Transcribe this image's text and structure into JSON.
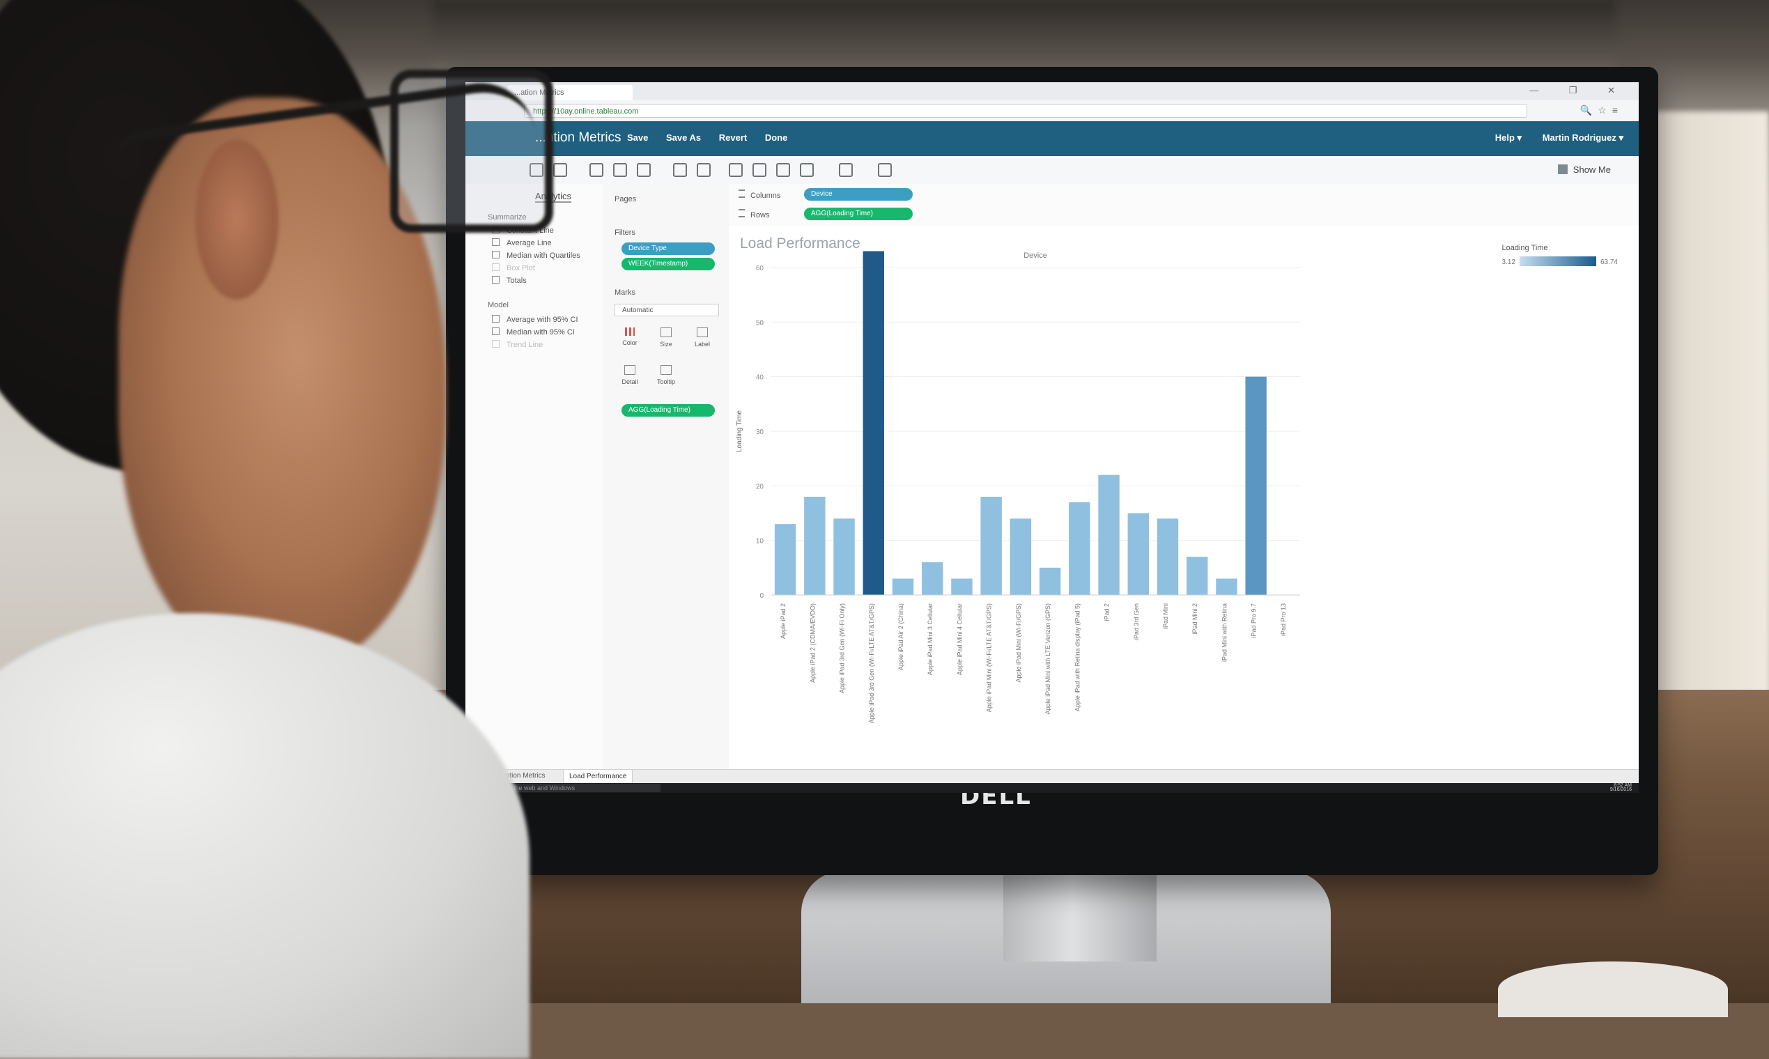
{
  "browser": {
    "tab_label": "...ation Metrics",
    "url": "https://10ay.online.tableau.com",
    "window_controls": "— ❐ ✕",
    "address_icons": "🔍☆≡"
  },
  "app": {
    "title": "...ntion Metrics",
    "menu": [
      "Save",
      "Save As",
      "Revert",
      "Done"
    ],
    "help_label": "Help ▾",
    "user_label": "Martin Rodriguez ▾",
    "show_me": "Show Me"
  },
  "analytics_pane": {
    "tab_label": "Analytics",
    "summarize_label": "Summarize",
    "summarize_items": [
      "Constant Line",
      "Average Line",
      "Median with Quartiles",
      "Box Plot",
      "Totals"
    ],
    "model_label": "Model",
    "model_items": [
      "Average with 95% CI",
      "Median with 95% CI",
      "Trend Line"
    ]
  },
  "cards": {
    "pages_label": "Pages",
    "filters_label": "Filters",
    "filters": [
      "Device Type",
      "WEEK(Timestamp)"
    ],
    "marks_label": "Marks",
    "mark_type": "Automatic",
    "mark_buttons": [
      "Color",
      "Size",
      "Label",
      "Detail",
      "Tooltip"
    ],
    "color_pill": "AGG(Loading Time)"
  },
  "shelves": {
    "columns_label": "Columns",
    "columns_pill": "Device",
    "rows_label": "Rows",
    "rows_pill": "AGG(Loading Time)"
  },
  "sheet_title": "Load Performance",
  "legend": {
    "title": "Loading Time",
    "min": "3.12",
    "max": "63.74"
  },
  "colors": {
    "bar_light": "#8fc0e0",
    "bar_mid": "#5b95c2",
    "bar_dark": "#1f5a8a",
    "header": "#1f5f80",
    "pill_green": "#17b86d",
    "pill_blue": "#3d9ec4"
  },
  "chart_data": {
    "type": "bar",
    "title": "Load Performance",
    "xlabel": "Device",
    "ylabel": "Loading Time",
    "ylim": [
      0,
      60
    ],
    "yticks": [
      0,
      10,
      20,
      30,
      40,
      50,
      60
    ],
    "grid": true,
    "legend": "top-right",
    "categories": [
      "Apple iPad 2",
      "Apple iPad 2 (CDMA/EVDO)",
      "Apple iPad 3rd Gen (Wi-Fi Only)",
      "Apple iPad 3rd Gen (Wi-Fi/LTE AT&T/GPS)",
      "Apple iPad Air 2 (China)",
      "Apple iPad Mini 3 Cellular",
      "Apple iPad Mini 4 Cellular",
      "Apple iPad Mini (Wi-Fi/LTE AT&T/GPS)",
      "Apple iPad Mini (Wi-Fi/GPS)",
      "Apple iPad Mini with LTE Verizon (GPS)",
      "Apple iPad with Retina display (iPad 5)",
      "iPad 2",
      "iPad 3rd Gen",
      "iPad Mini",
      "iPad Mini 2",
      "iPad Mini with Retina",
      "iPad Pro 9.7",
      "iPad Pro 13"
    ],
    "values": [
      13,
      18,
      14,
      63,
      3,
      6,
      3,
      18,
      14,
      5,
      17,
      22,
      15,
      14,
      7,
      3,
      40,
      0
    ],
    "note_last_value": "last category bar not visible"
  },
  "sheet_tabs": [
    "App Adoption Metrics",
    "Load Performance"
  ],
  "taskbar": {
    "search_placeholder": "Search the web and Windows",
    "time": "8:52 AM",
    "date": "9/16/2016"
  },
  "monitor_brand": "DELL"
}
